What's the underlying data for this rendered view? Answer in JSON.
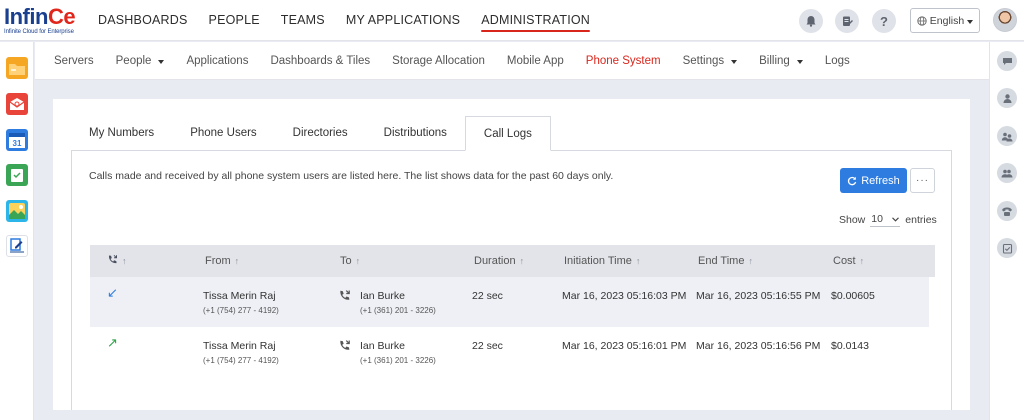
{
  "brand": {
    "name_part1": "Infin",
    "name_part2": "Ce",
    "tagline": "Infinite Cloud for Enterprise"
  },
  "topnav": {
    "items": [
      "DASHBOARDS",
      "PEOPLE",
      "TEAMS",
      "MY APPLICATIONS",
      "ADMINISTRATION"
    ],
    "active": "ADMINISTRATION"
  },
  "header": {
    "help_glyph": "?",
    "language": "English"
  },
  "subnav": {
    "items": [
      "Servers",
      "People",
      "Applications",
      "Dashboards & Tiles",
      "Storage Allocation",
      "Mobile App",
      "Phone System",
      "Settings",
      "Billing",
      "Logs"
    ],
    "active": "Phone System"
  },
  "left_apps": [
    "folder-icon",
    "email-icon",
    "calendar-icon",
    "tasks-icon",
    "photos-icon",
    "forms-icon"
  ],
  "calendar_day": "31",
  "right_tools": [
    "chat-icon",
    "person-icon",
    "people-icon",
    "group-icon",
    "phone-icon",
    "checklist-icon"
  ],
  "tabs": [
    "My Numbers",
    "Phone Users",
    "Directories",
    "Distributions",
    "Call Logs"
  ],
  "active_tab": "Call Logs",
  "call_logs": {
    "description": "Calls made and received by all phone system users are listed here. The list shows data for the past 60 days only.",
    "refresh_label": "Refresh",
    "more_label": "···",
    "show_label": "Show",
    "entries_value": "10",
    "entries_label": "entries",
    "columns": [
      "From",
      "To",
      "Duration",
      "Initiation Time",
      "End Time",
      "Cost"
    ],
    "rows": [
      {
        "direction": "incoming",
        "direction_glyph": "↙",
        "direction_color": "#2e7ce0",
        "from_name": "Tissa Merin Raj",
        "from_number": "(+1 (754) 277 - 4192)",
        "to_name": "Ian Burke",
        "to_number": "(+1 (361) 201 - 3226)",
        "duration": "22 sec",
        "initiation_time": "Mar 16, 2023 05:16:03 PM",
        "end_time": "Mar 16, 2023 05:16:55 PM",
        "cost": "$0.00605"
      },
      {
        "direction": "outgoing",
        "direction_glyph": "↗",
        "direction_color": "#2fa34a",
        "from_name": "Tissa Merin Raj",
        "from_number": "(+1 (754) 277 - 4192)",
        "to_name": "Ian Burke",
        "to_number": "(+1 (361) 201 - 3226)",
        "duration": "22 sec",
        "initiation_time": "Mar 16, 2023 05:16:01 PM",
        "end_time": "Mar 16, 2023 05:16:56 PM",
        "cost": "$0.0143"
      }
    ]
  },
  "colors": {
    "accent_red": "#d9261c",
    "primary_blue": "#2e7ce0"
  }
}
